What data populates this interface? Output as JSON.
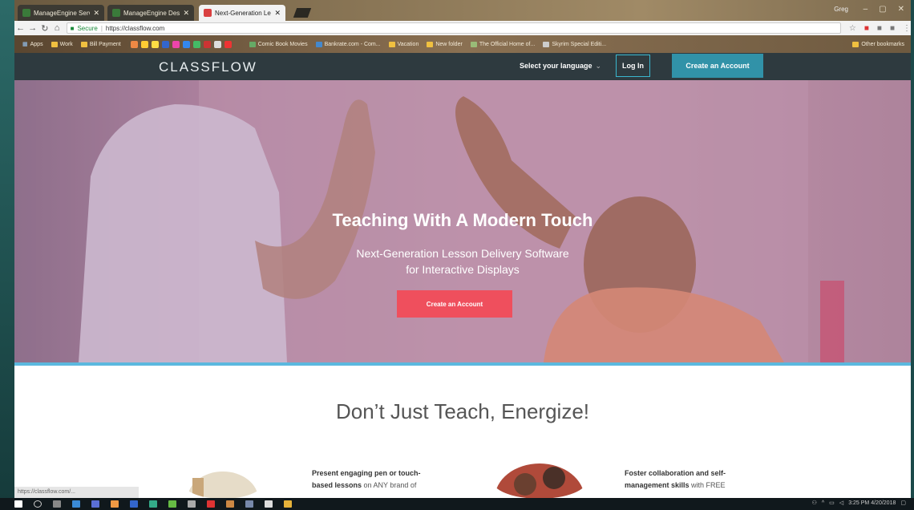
{
  "browser": {
    "tabs": [
      {
        "label": "ManageEngine ServiceD",
        "active": false,
        "color": "#3a7a3a"
      },
      {
        "label": "ManageEngine Desktop",
        "active": false,
        "color": "#3a7a3a"
      },
      {
        "label": "Next-Generation Lesso",
        "active": true,
        "color": "#d94040"
      }
    ],
    "user_label": "Greg",
    "url_secure": "Secure",
    "url": "https://classflow.com",
    "bookmarks": {
      "apps": "Apps",
      "work": "Work",
      "bill_payment": "Bill Payment",
      "comic": "Comic Book Movies",
      "bankrate": "Bankrate.com - Com...",
      "vacation": "Vacation",
      "new_folder": "New folder",
      "official_home": "The Official Home of...",
      "skyrim": "Skyrim Special Editi...",
      "other": "Other bookmarks"
    },
    "status_url": "https://classflow.com/..."
  },
  "site": {
    "logo": "CLASSFLOW",
    "language": "Select your language",
    "login": "Log In",
    "create_account_top": "Create an Account"
  },
  "hero": {
    "title": "Teaching With A Modern Touch",
    "subtitle_line1": "Next-Generation Lesson Delivery Software",
    "subtitle_line2": "for Interactive Displays",
    "cta": "Create an Account"
  },
  "content": {
    "section_title": "Don’t Just Teach, Energize!",
    "feature1": {
      "line1_bold": "Present engaging pen or touch-",
      "line2_bold": "based lessons",
      "line2_rest": " on ANY brand of"
    },
    "feature2": {
      "line1_bold": "Foster collaboration and self-",
      "line2_bold": "management skills",
      "line2_rest": " with FREE"
    }
  },
  "taskbar": {
    "time": "3:25 PM",
    "date": "4/20/2018"
  },
  "colors": {
    "header_bg": "#2e3a3f",
    "accent_teal": "#3192a8",
    "cta_red": "#ef4f5d",
    "hero_bar": "#5bb8de"
  }
}
